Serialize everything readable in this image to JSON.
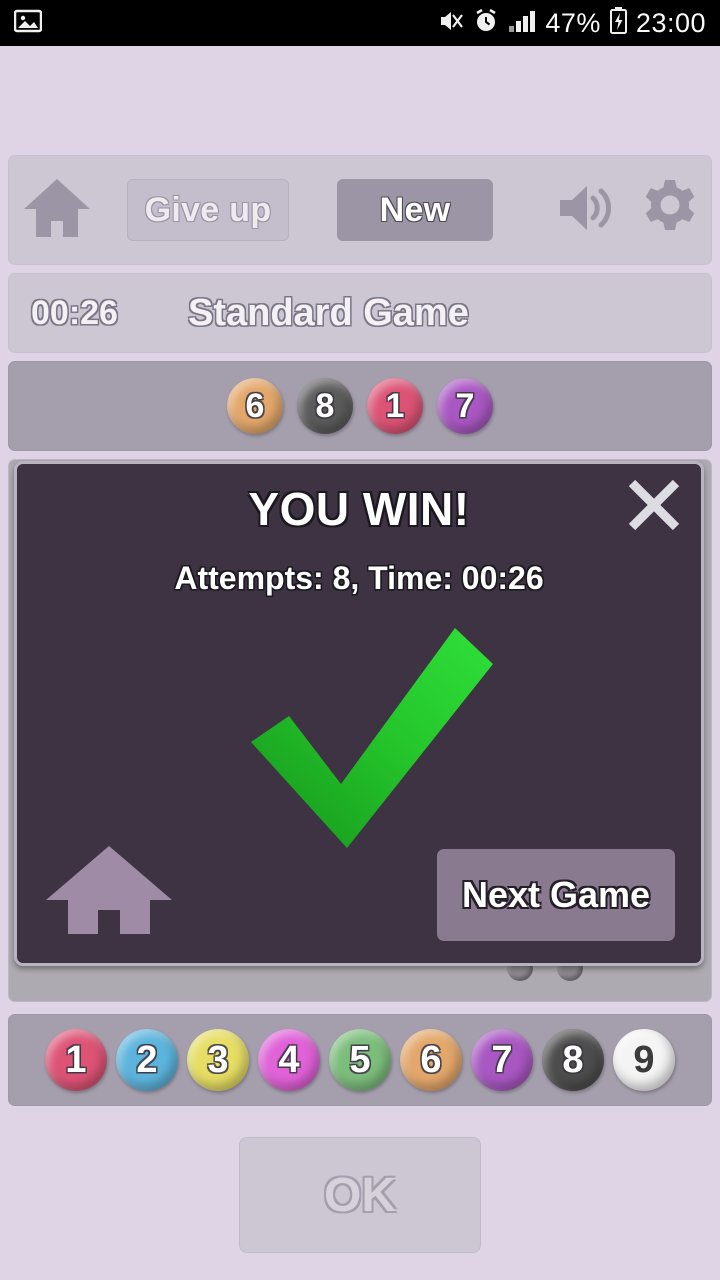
{
  "statusbar": {
    "left_icon": "image-icon",
    "icons": [
      "mute-vibrate-icon",
      "alarm-icon",
      "signal-icon"
    ],
    "battery_percent": "47%",
    "battery_icon": "battery-charging-icon",
    "clock": "23:00"
  },
  "toolbar": {
    "home_icon": "home-icon",
    "give_up_label": "Give up",
    "new_label": "New",
    "speaker_icon": "speaker-on-icon",
    "gear_icon": "gear-icon"
  },
  "infobar": {
    "timer": "00:26",
    "mode": "Standard Game"
  },
  "secret_code": [
    {
      "number": "6",
      "color": "#e3a76b"
    },
    {
      "number": "8",
      "color": "#5b5b5b"
    },
    {
      "number": "1",
      "color": "#dd5375"
    },
    {
      "number": "7",
      "color": "#a957c2"
    }
  ],
  "dialog": {
    "title": "YOU WIN!",
    "stats": "Attempts: 8, Time: 00:26",
    "close_icon": "close-icon",
    "check_icon": "check-mark-icon",
    "check_color_light": "#2fe03a",
    "check_color_dark": "#17941c",
    "home_icon": "home-icon",
    "next_game_label": "Next Game"
  },
  "palette": [
    {
      "number": "1",
      "color": "#dd5375",
      "dark_text": false
    },
    {
      "number": "2",
      "color": "#5cb4dd",
      "dark_text": false
    },
    {
      "number": "3",
      "color": "#e6dd63",
      "dark_text": false
    },
    {
      "number": "4",
      "color": "#e061d8",
      "dark_text": false
    },
    {
      "number": "5",
      "color": "#7cbd7c",
      "dark_text": false
    },
    {
      "number": "6",
      "color": "#e3a76b",
      "dark_text": false
    },
    {
      "number": "7",
      "color": "#a957c2",
      "dark_text": false
    },
    {
      "number": "8",
      "color": "#4d4d4d",
      "dark_text": false
    },
    {
      "number": "9",
      "color": "#f4f4f4",
      "dark_text": true
    }
  ],
  "ok_button": {
    "label": "OK"
  },
  "theme": {
    "background": "#ded4e6",
    "panel": "#cdc7d3",
    "board": "#aeaab2",
    "dialog_bg": "#3d3342"
  }
}
